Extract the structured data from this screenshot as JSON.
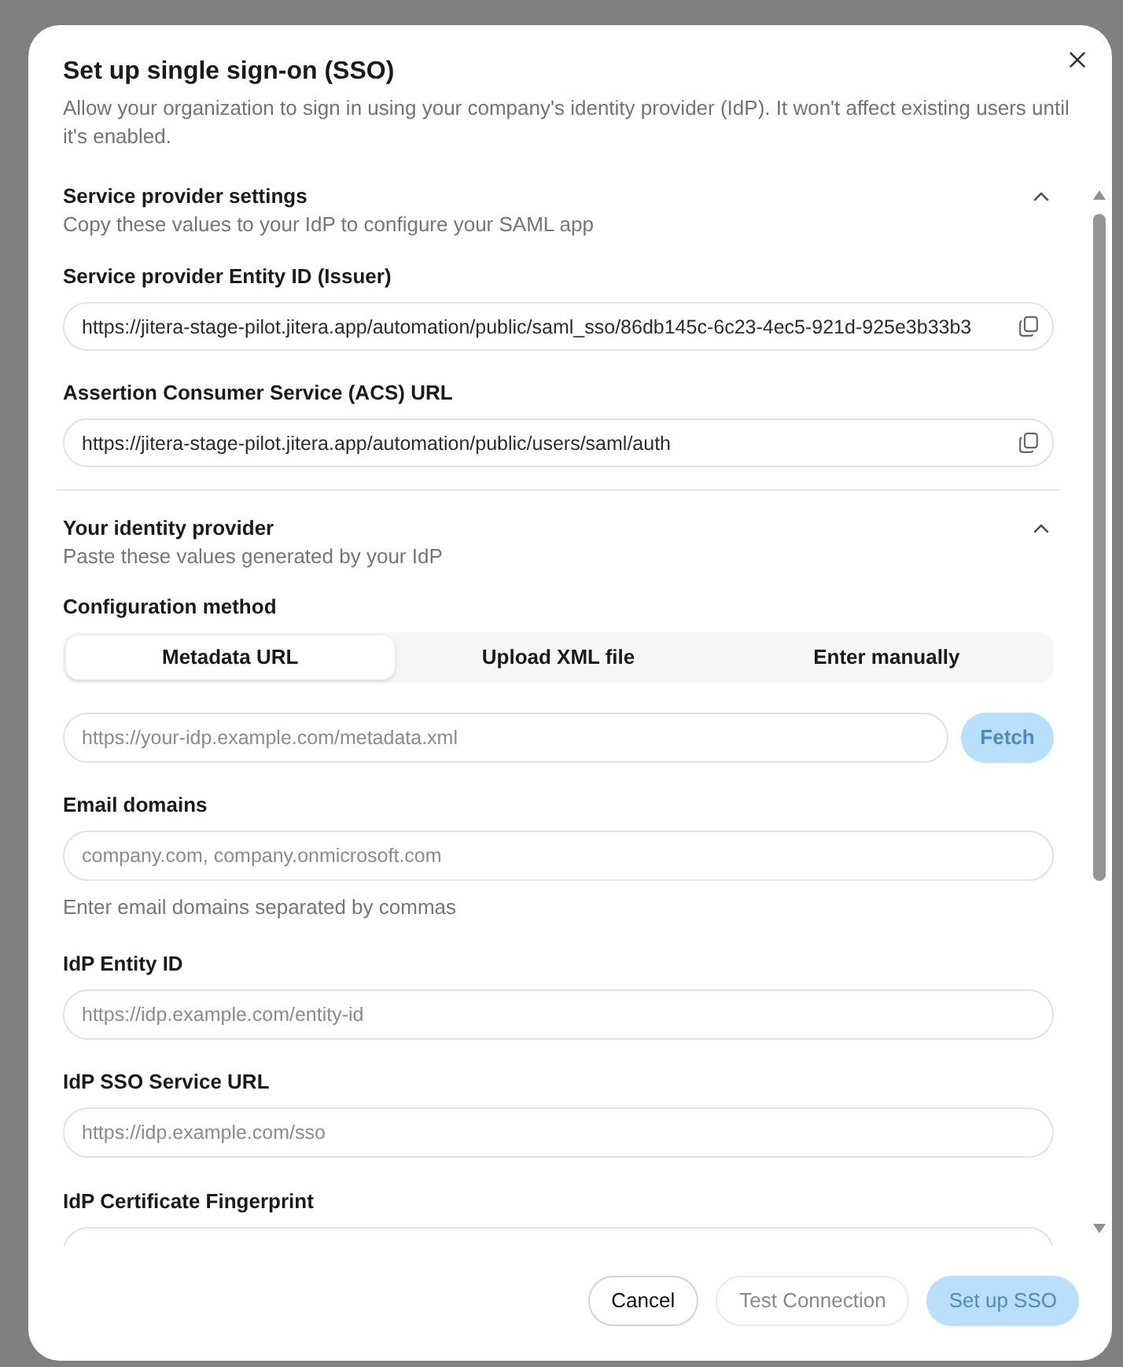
{
  "dialog": {
    "title": "Set up single sign-on (SSO)",
    "description": "Allow your organization to sign in using your company's identity provider (IdP). It won't affect existing users until it's enabled."
  },
  "service_provider": {
    "title": "Service provider settings",
    "subtitle": "Copy these values to your IdP to configure your SAML app",
    "expanded": true,
    "fields": [
      {
        "label": "Service provider Entity ID (Issuer)",
        "value": "https://jitera-stage-pilot.jitera.app/automation/public/saml_sso/86db145c-6c23-4ec5-921d-925e3b33b3"
      },
      {
        "label": "Assertion Consumer Service (ACS) URL",
        "value": "https://jitera-stage-pilot.jitera.app/automation/public/users/saml/auth"
      }
    ]
  },
  "identity_provider": {
    "title": "Your identity provider",
    "subtitle": "Paste these values generated by your IdP",
    "expanded": true,
    "configuration_method": {
      "label": "Configuration method",
      "options": [
        {
          "label": "Metadata URL",
          "selected": true
        },
        {
          "label": "Upload XML file",
          "selected": false
        },
        {
          "label": "Enter manually",
          "selected": false
        }
      ]
    },
    "metadata_url": {
      "placeholder": "https://your-idp.example.com/metadata.xml",
      "fetch_button": {
        "label": "Fetch",
        "disabled": true
      }
    },
    "fields": [
      {
        "label": "Email domains",
        "placeholder": "company.com, company.onmicrosoft.com",
        "hint": "Enter email domains separated by commas"
      },
      {
        "label": "IdP Entity ID",
        "placeholder": "https://idp.example.com/entity-id"
      },
      {
        "label": "IdP SSO Service URL",
        "placeholder": "https://idp.example.com/sso"
      },
      {
        "label": "IdP Certificate Fingerprint"
      }
    ]
  },
  "footer": {
    "buttons": [
      {
        "label": "Cancel",
        "kind": "outline",
        "disabled": false
      },
      {
        "label": "Test Connection",
        "kind": "outline",
        "disabled": true
      },
      {
        "label": "Set up SSO",
        "kind": "primary",
        "disabled": true
      }
    ]
  }
}
